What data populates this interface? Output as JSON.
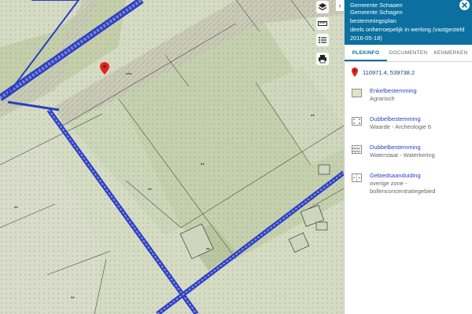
{
  "panel": {
    "header": {
      "title_partial": "Gemeente Schagen",
      "municipality": "Gemeente Schagen",
      "plan_type": "bestemmingsplan",
      "status_line1": "deels onherroepelijk in werking (vastgesteld",
      "status_line2": "2016-05-18)"
    },
    "collapse_glyph": "›",
    "tabs": [
      {
        "label": "PLEKINFO",
        "active": true
      },
      {
        "label": "DOCUMENTEN",
        "active": false
      },
      {
        "label": "KENMERKEN",
        "active": false
      }
    ],
    "coordinates": "110971.4, 539738.2",
    "legend": [
      {
        "title": "Enkelbestemming",
        "sub1": "Agrarisch",
        "sub2": "",
        "swatch": "agrarisch"
      },
      {
        "title": "Dubbelbestemming",
        "sub1": "Waarde - Archeologie 6",
        "sub2": "",
        "swatch": "archeologie"
      },
      {
        "title": "Dubbelbestemming",
        "sub1": "Waterstaat - Waterkering",
        "sub2": "",
        "swatch": "waterkering"
      },
      {
        "title": "Gebiedsaanduiding",
        "sub1": "overige zone -",
        "sub2": "bollenconcentratiegebied",
        "swatch": "gebied"
      }
    ]
  },
  "map": {
    "tools": [
      "layers-icon",
      "ruler-icon",
      "legend-list-icon",
      "print-icon"
    ],
    "marker": "location-pin-icon"
  },
  "colors": {
    "header_bg": "#0b6fa0",
    "link": "#2b3fbf",
    "coord_text": "#154273",
    "pin": "#e0261b",
    "agrarisch": "#dfe6c8",
    "road_blue": "#2c3ec6"
  }
}
